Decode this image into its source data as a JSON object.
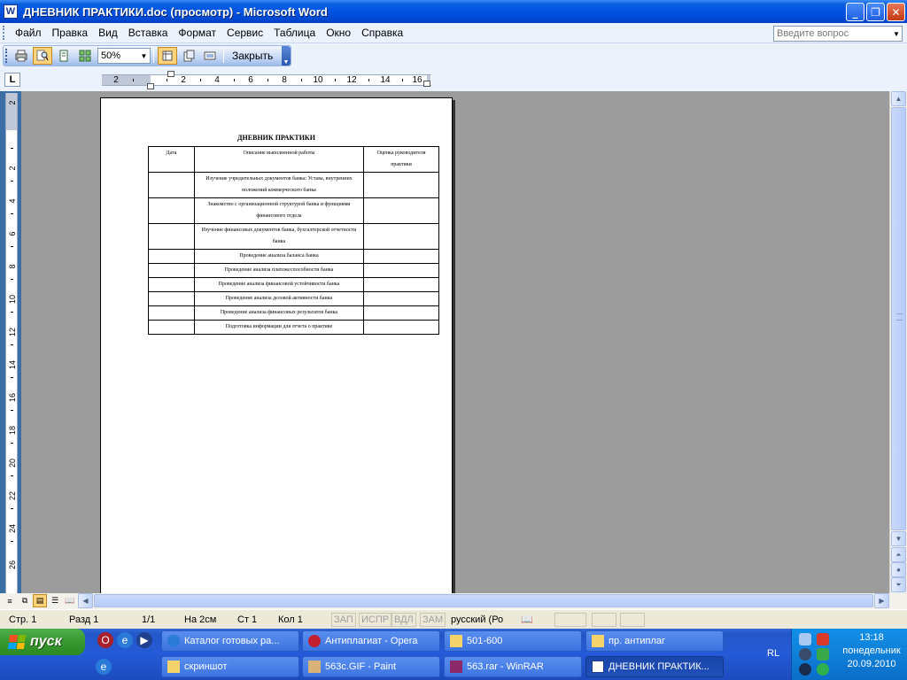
{
  "window": {
    "title": "ДНЕВНИК ПРАКТИКИ.doc (просмотр) - Microsoft Word",
    "app_icon_letter": "W",
    "minimize_glyph": "_",
    "maximize_glyph": "❐",
    "close_glyph": "✕"
  },
  "menu": {
    "items": [
      {
        "label": "Файл"
      },
      {
        "label": "Правка"
      },
      {
        "label": "Вид"
      },
      {
        "label": "Вставка"
      },
      {
        "label": "Формат"
      },
      {
        "label": "Сервис"
      },
      {
        "label": "Таблица"
      },
      {
        "label": "Окно"
      },
      {
        "label": "Справка"
      }
    ],
    "ask_placeholder": "Введите вопрос"
  },
  "toolbar": {
    "zoom_value": "50%",
    "close_label": "Закрыть"
  },
  "ruler": {
    "corner": "L",
    "h_labels": [
      "2",
      "2",
      "4",
      "6",
      "8",
      "10",
      "12",
      "14",
      "16"
    ],
    "v_labels": [
      "2",
      "2",
      "4",
      "6",
      "8",
      "10",
      "12",
      "14",
      "16",
      "18",
      "20",
      "22",
      "24",
      "26"
    ]
  },
  "document": {
    "title": "ДНЕВНИК ПРАКТИКИ",
    "table": {
      "headers": [
        "Дата",
        "Описание выполненной работы",
        "Оценка руководителя практики"
      ],
      "rows": [
        [
          "",
          "Изучение учредительных документов банка: Устава, внутренних положений коммерческого банка",
          ""
        ],
        [
          "",
          "Знакомство с организационной структурой банка и функциями финансового отдела",
          ""
        ],
        [
          "",
          "Изучение финансовых документов банка, бухгалтерской отчетности банка",
          ""
        ],
        [
          "",
          "Проведение анализа баланса банка",
          ""
        ],
        [
          "",
          "Проведение анализа платежеспособности банка",
          ""
        ],
        [
          "",
          "Проведение анализа финансовой устойчивости банка",
          ""
        ],
        [
          "",
          "Проведение анализа деловой активности банка",
          ""
        ],
        [
          "",
          "Проведение анализа финансовых результатов банка",
          ""
        ],
        [
          "",
          "Подготовка информации для отчета о практике",
          ""
        ]
      ]
    }
  },
  "status": {
    "page": "Стр. 1",
    "section": "Разд 1",
    "pages": "1/1",
    "at": "На 2см",
    "line": "Ст 1",
    "col": "Кол 1",
    "rec": "ЗАП",
    "trk": "ИСПР",
    "ext": "ВДЛ",
    "ovr": "ЗАМ",
    "language": "русский (Ро"
  },
  "taskbar": {
    "start_label": "пуск",
    "tasks_row1": [
      {
        "label": "Каталог готовых ра...",
        "icon": "ie-icon"
      },
      {
        "label": "Антиплагиат - Opera",
        "icon": "opera-icon"
      },
      {
        "label": "501-600",
        "icon": "folder-icon"
      },
      {
        "label": "пр. антиплаг",
        "icon": "folder-icon"
      }
    ],
    "tasks_row2": [
      {
        "label": "скриншот",
        "icon": "folder-icon"
      },
      {
        "label": "563c.GIF - Paint",
        "icon": "paint-icon"
      },
      {
        "label": "563.rar - WinRAR",
        "icon": "winrar-icon"
      },
      {
        "label": "ДНЕВНИК ПРАКТИК...",
        "icon": "word-icon"
      }
    ],
    "language_indicator": "RL",
    "clock_time": "13:18",
    "clock_day": "понедельник",
    "clock_date": "20.09.2010"
  },
  "colors": {
    "titlebar": "#0054e3",
    "doc_background": "#9c9c9c",
    "taskbar": "#245ad8",
    "start_button": "#37962f",
    "tray": "#0f7fd8"
  }
}
